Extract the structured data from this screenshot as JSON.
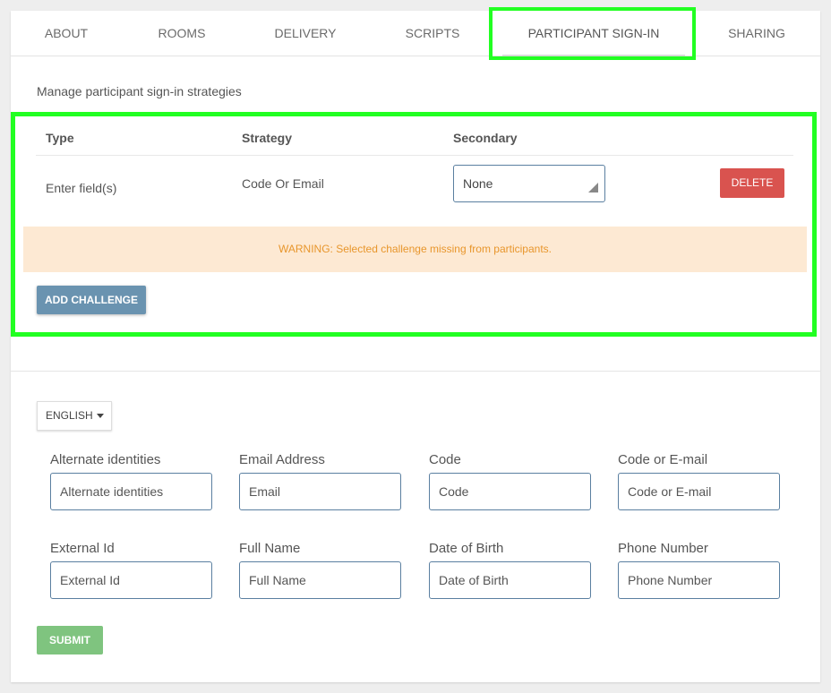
{
  "tabs": [
    "About",
    "Rooms",
    "Delivery",
    "Scripts",
    "Participant Sign-In",
    "Sharing"
  ],
  "active_tab": "Participant Sign-In",
  "section": {
    "subtitle": "Manage participant sign-in strategies",
    "table": {
      "headers": {
        "type": "Type",
        "strategy": "Strategy",
        "secondary": "Secondary"
      },
      "row": {
        "type": "Enter field(s)",
        "strategy": "Code Or Email",
        "secondary_value": "None",
        "delete_label": "DELETE"
      }
    },
    "warning": "WARNING: Selected challenge missing from participants.",
    "add_challenge_label": "ADD CHALLENGE"
  },
  "form": {
    "language": "ENGLISH",
    "fields": [
      {
        "label": "Alternate identities",
        "placeholder": "Alternate identities"
      },
      {
        "label": "Email Address",
        "placeholder": "Email"
      },
      {
        "label": "Code",
        "placeholder": "Code"
      },
      {
        "label": "Code or E-mail",
        "placeholder": "Code or E-mail"
      },
      {
        "label": "External Id",
        "placeholder": "External Id"
      },
      {
        "label": "Full Name",
        "placeholder": "Full Name"
      },
      {
        "label": "Date of Birth",
        "placeholder": "Date of Birth"
      },
      {
        "label": "Phone Number",
        "placeholder": "Phone Number"
      }
    ],
    "submit_label": "SUBMIT"
  },
  "colors": {
    "highlight": "#22ff22",
    "delete": "#d9534f",
    "warning_bg": "#fde9d3",
    "warning_text": "#e8962c",
    "add_button": "#6a93b0",
    "submit_button": "#7fc47f"
  }
}
